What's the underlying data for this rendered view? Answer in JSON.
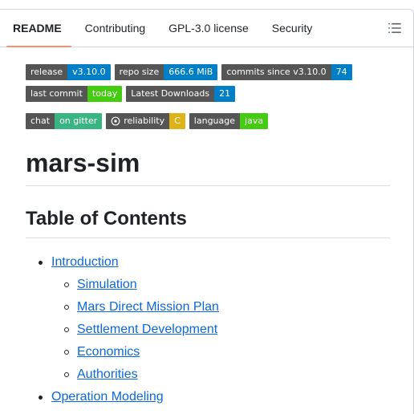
{
  "tabs": [
    {
      "label": "README"
    },
    {
      "label": "Contributing"
    },
    {
      "label": "GPL-3.0 license"
    },
    {
      "label": "Security"
    }
  ],
  "badges_row1": [
    {
      "left": "release",
      "right": "v3.10.0",
      "color": "#007ec6"
    },
    {
      "left": "repo size",
      "right": "666.6 MiB",
      "color": "#007ec6"
    },
    {
      "left": "commits since v3.10.0",
      "right": "74",
      "color": "#007ec6"
    }
  ],
  "badges_row2": [
    {
      "left": "last commit",
      "right": "today",
      "color": "#44cc11"
    },
    {
      "left": "Latest Downloads",
      "right": "21",
      "color": "#007ec6"
    }
  ],
  "badges_row3": [
    {
      "left": "chat",
      "right": "on gitter",
      "color": "#38b580"
    },
    {
      "left": "reliability",
      "right": "C",
      "color": "#dfb317"
    },
    {
      "left": "language",
      "right": "java",
      "color": "#44cc11"
    }
  ],
  "title": "mars-sim",
  "toc_heading": "Table of Contents",
  "toc": [
    {
      "label": "Introduction",
      "children": [
        {
          "label": "Simulation"
        },
        {
          "label": "Mars Direct Mission Plan"
        },
        {
          "label": "Settlement Development"
        },
        {
          "label": "Economics"
        },
        {
          "label": "Authorities"
        }
      ]
    },
    {
      "label": "Operation Modeling"
    }
  ]
}
